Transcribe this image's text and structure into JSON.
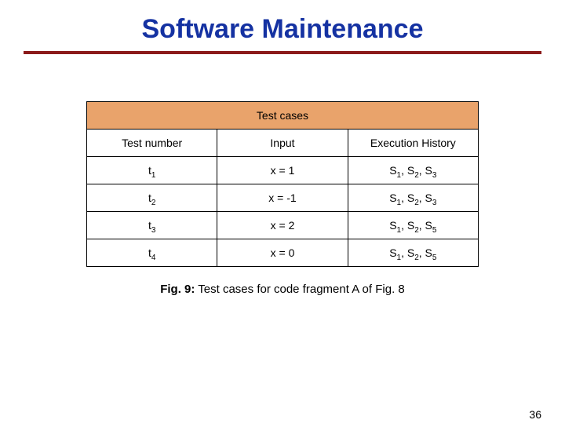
{
  "title": "Software Maintenance",
  "table": {
    "header_top": "Test cases",
    "columns": [
      "Test number",
      "Input",
      "Execution History"
    ],
    "rows": [
      {
        "num_base": "t",
        "num_sub": "1",
        "input": "x = 1",
        "hist": [
          1,
          2,
          3
        ]
      },
      {
        "num_base": "t",
        "num_sub": "2",
        "input": "x = -1",
        "hist": [
          1,
          2,
          3
        ]
      },
      {
        "num_base": "t",
        "num_sub": "3",
        "input": "x = 2",
        "hist": [
          1,
          2,
          5
        ]
      },
      {
        "num_base": "t",
        "num_sub": "4",
        "input": "x = 0",
        "hist": [
          1,
          2,
          5
        ]
      }
    ]
  },
  "caption_lead": "Fig. 9:",
  "caption_rest": " Test cases for code fragment A of Fig. 8",
  "page_number": "36"
}
